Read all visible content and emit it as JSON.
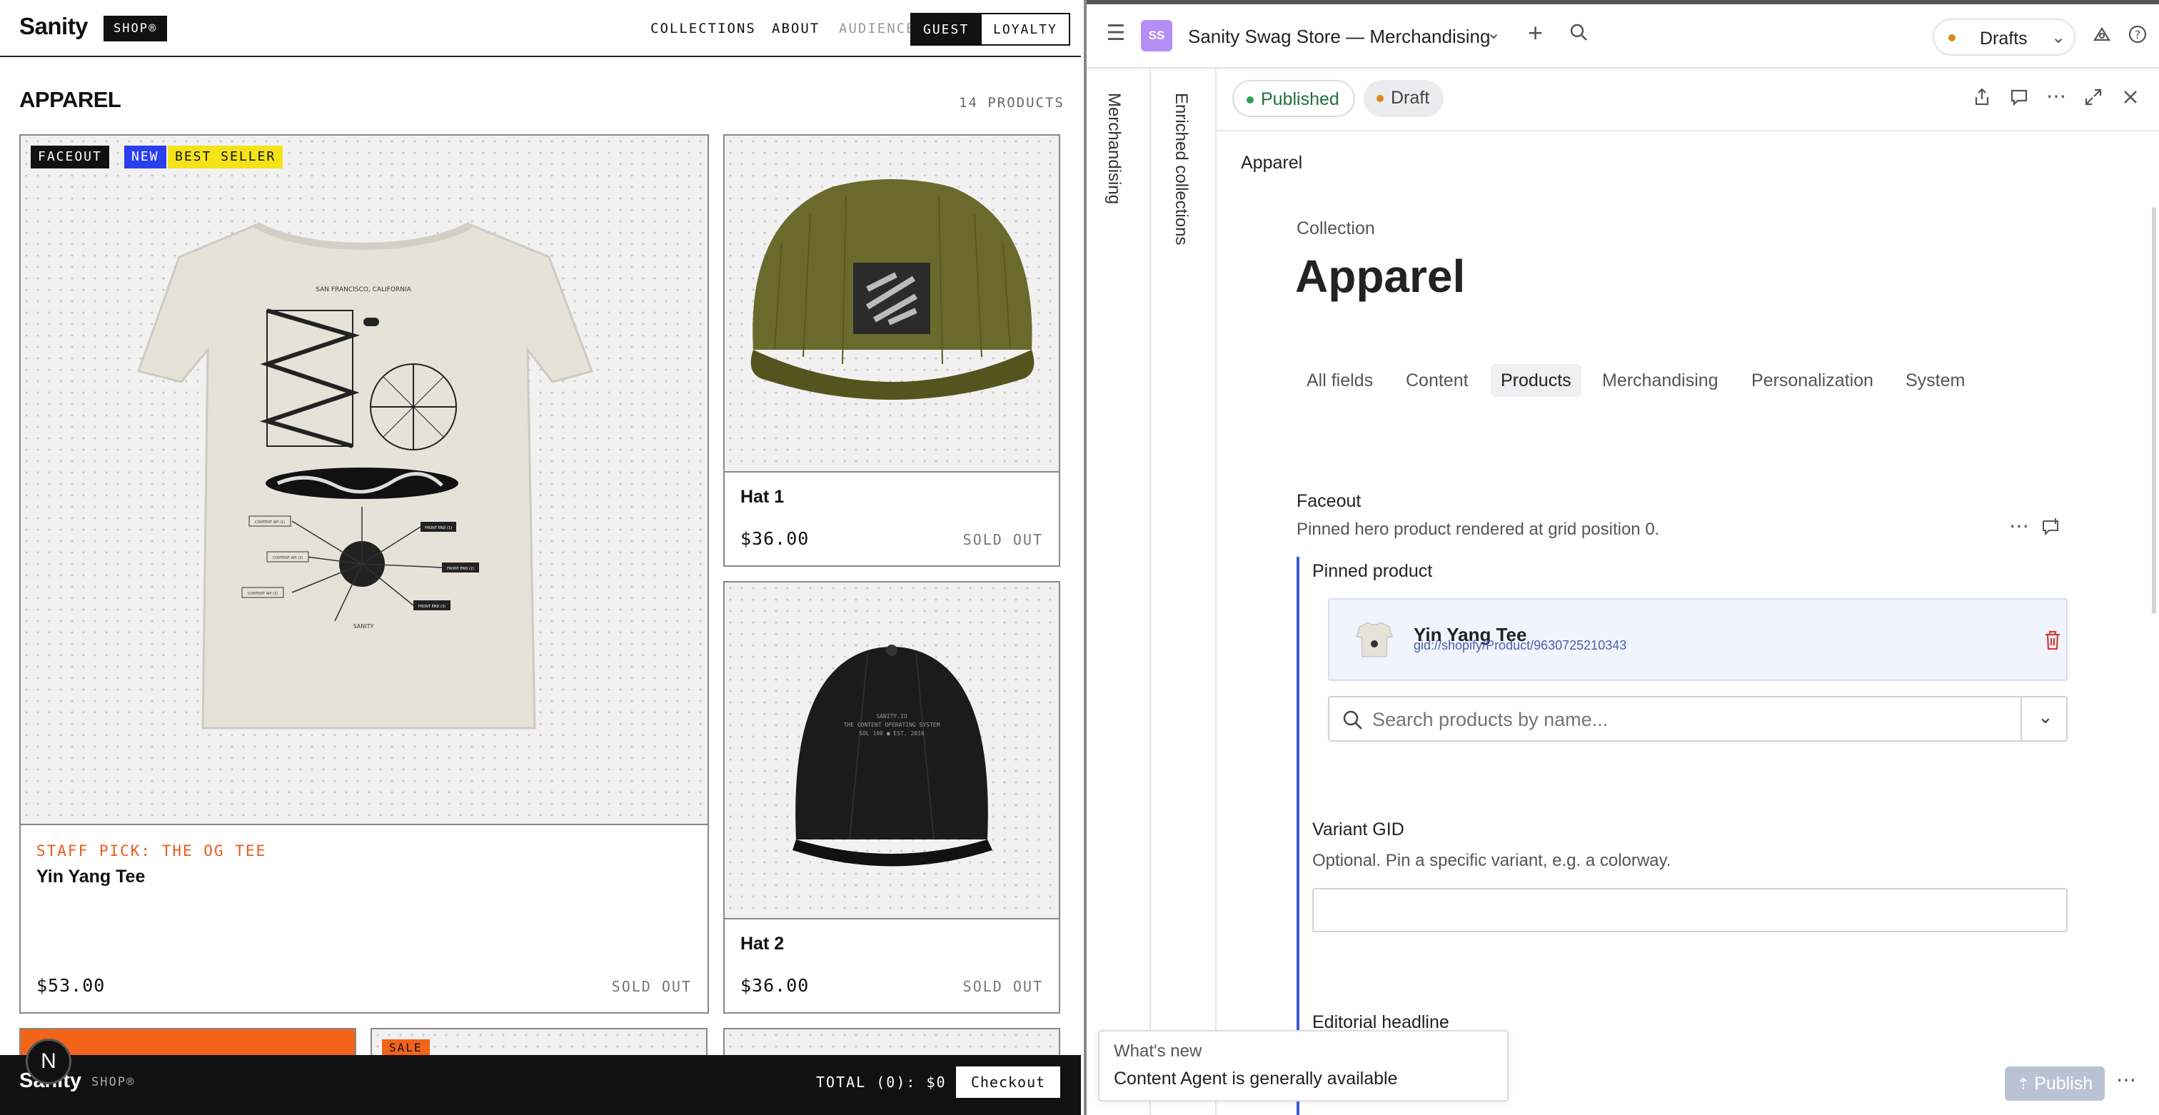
{
  "shop": {
    "logo": "Sanity",
    "shop_badge": "SHOP®",
    "nav": [
      "COLLECTIONS",
      "ABOUT",
      "AUDIENCE"
    ],
    "guest": "GUEST",
    "loyalty": "LOYALTY",
    "collection_title": "APPAREL",
    "product_count": "14 PRODUCTS",
    "featured": {
      "tags": [
        "FACEOUT",
        "NEW",
        "BEST SELLER"
      ],
      "tag_colors": [
        "#111111",
        "#2a3ff0",
        "#f4e319"
      ],
      "staff_pick": "STAFF PICK: THE OG TEE",
      "name": "Yin Yang Tee",
      "price": "$53.00",
      "status": "SOLD OUT",
      "tee_print_text": [
        "SAN FRANCISCO, CALIFORNIA",
        "CONTENT API (1)",
        "CONTENT API (2)",
        "CONTENT API (3)",
        "FRONT END (1)",
        "FRONT END (2)",
        "FRONT END (3)",
        "SANITY"
      ]
    },
    "products": [
      {
        "name": "Hat 1",
        "price": "$36.00",
        "status": "SOLD OUT"
      },
      {
        "name": "Hat 2",
        "price": "$36.00",
        "status": "SOLD OUT",
        "hat_text": [
          "SANITY.IO",
          "THE CONTENT OPERATING SYSTEM",
          "SOL 100 ● EST. 2016"
        ]
      }
    ],
    "sale_tag": "SALE",
    "bottom": {
      "logo": "Sanity",
      "shop": "SHOP®",
      "total": "TOTAL (0): $0",
      "checkout": "Checkout"
    },
    "nav_badge": "N"
  },
  "studio": {
    "workspace_initials": "SS",
    "workspace_title": "Sanity Swag Store — Merchandising",
    "perspective": "Drafts",
    "pane_tabs": [
      "Merchandising",
      "Enriched collections"
    ],
    "status_published": "Published",
    "status_draft": "Draft",
    "breadcrumb": "Apparel",
    "doc_type": "Collection",
    "doc_title": "Apparel",
    "tabs": [
      "All fields",
      "Content",
      "Products",
      "Merchandising",
      "Personalization",
      "System"
    ],
    "active_tab": "Products",
    "faceout": {
      "label": "Faceout",
      "description": "Pinned hero product rendered at grid position 0.",
      "pinned_label": "Pinned product",
      "product_name": "Yin Yang Tee",
      "product_gid": "gid://shopify/Product/9630725210343",
      "search_placeholder": "Search products by name..."
    },
    "variant": {
      "label": "Variant GID",
      "description": "Optional. Pin a specific variant, e.g. a colorway.",
      "value": ""
    },
    "editorial_headline_label": "Editorial headline",
    "toast": {
      "title": "What's new",
      "message": "Content Agent is generally available"
    },
    "publish": "Publish",
    "colors": {
      "accent": "#3b5bdb",
      "published": "#2e9e55",
      "draft": "#d98a1a",
      "delete": "#d63a3a"
    }
  }
}
